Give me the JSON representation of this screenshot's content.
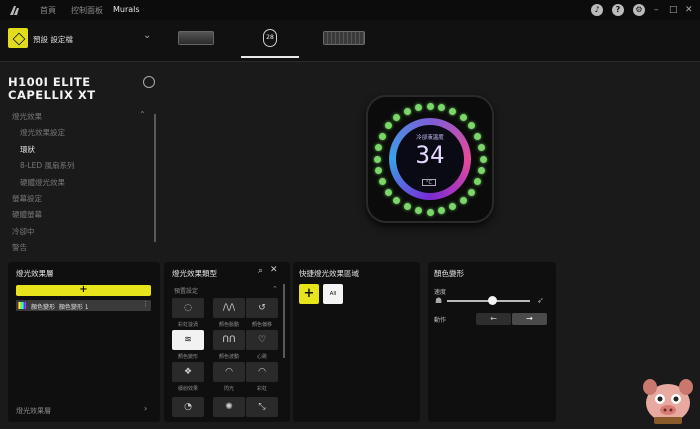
{
  "nav": {
    "items": [
      "首頁",
      "控制面板",
      "Murals"
    ],
    "active_index": 2,
    "icons": [
      "bell-icon",
      "help-icon",
      "settings-icon"
    ],
    "window_controls": [
      "–",
      "□",
      "✕"
    ]
  },
  "profile": {
    "name": "預設 設定檔"
  },
  "devices": {
    "items": [
      "dashboard-strip",
      "h100i-pump",
      "keyboard"
    ],
    "active_index": 1,
    "pump_glyph": "28"
  },
  "sidebar": {
    "device_title": "H100I ELITE CAPELLIX XT",
    "items": [
      {
        "label": "燈光效果",
        "level": 0,
        "active": false
      },
      {
        "label": "燈光效果設定",
        "level": 1,
        "active": false
      },
      {
        "label": "環狀",
        "level": 1,
        "active": true
      },
      {
        "label": "8-LED 風扇系列",
        "level": 1,
        "active": false
      },
      {
        "label": "硬體燈光效果",
        "level": 1,
        "active": false
      },
      {
        "label": "螢幕設定",
        "level": 0,
        "active": false
      },
      {
        "label": "硬體螢幕",
        "level": 0,
        "active": false
      },
      {
        "label": "冷卻中",
        "level": 0,
        "active": false
      },
      {
        "label": "警告",
        "level": 0,
        "active": false
      }
    ]
  },
  "preview": {
    "screen_label": "冷卻液溫度",
    "temperature": "34",
    "unit": "°C",
    "led_color": "#7cd66c"
  },
  "layers_panel": {
    "title": "燈光效果層",
    "add_label": "+",
    "layer_name": "顏色變形",
    "layer_detail": "顏色變形 1",
    "footer": "燈光效果層"
  },
  "effect_types_panel": {
    "title": "燈光效果類型",
    "section": "預置設定",
    "effects": [
      {
        "label": "彩虹漩渦",
        "glyph": "◌",
        "active": false
      },
      {
        "label": "顏色脈動",
        "glyph": "/\\/\\",
        "active": false
      },
      {
        "label": "顏色偏移",
        "glyph": "↺",
        "active": false
      },
      {
        "label": "顏色變形",
        "glyph": "≋",
        "active": true
      },
      {
        "label": "顏色波動",
        "glyph": "ᑎᑎ",
        "active": false
      },
      {
        "label": "心跳",
        "glyph": "♡",
        "active": false
      },
      {
        "label": "繽紛效果",
        "glyph": "❖",
        "active": false
      },
      {
        "label": "閃光",
        "glyph": "◠",
        "active": false
      },
      {
        "label": "彩虹",
        "glyph": "◠",
        "active": false
      },
      {
        "label": "",
        "glyph": "◔",
        "active": false
      },
      {
        "label": "",
        "glyph": "✺",
        "active": false
      },
      {
        "label": "",
        "glyph": "⤡",
        "active": false
      }
    ]
  },
  "quick_panel": {
    "title": "快捷燈光效果區域",
    "add_label": "+",
    "all_label": "All"
  },
  "color_shift_panel": {
    "title": "顏色變形",
    "speed_label": "速度",
    "speed_value": 0.55,
    "direction_label": "動作",
    "directions": [
      "←",
      "→"
    ],
    "direction_active": 1
  },
  "colors": {
    "accent": "#e8e41c",
    "panel_bg": "#0f0f0f",
    "page_bg": "#1a1a1a"
  }
}
